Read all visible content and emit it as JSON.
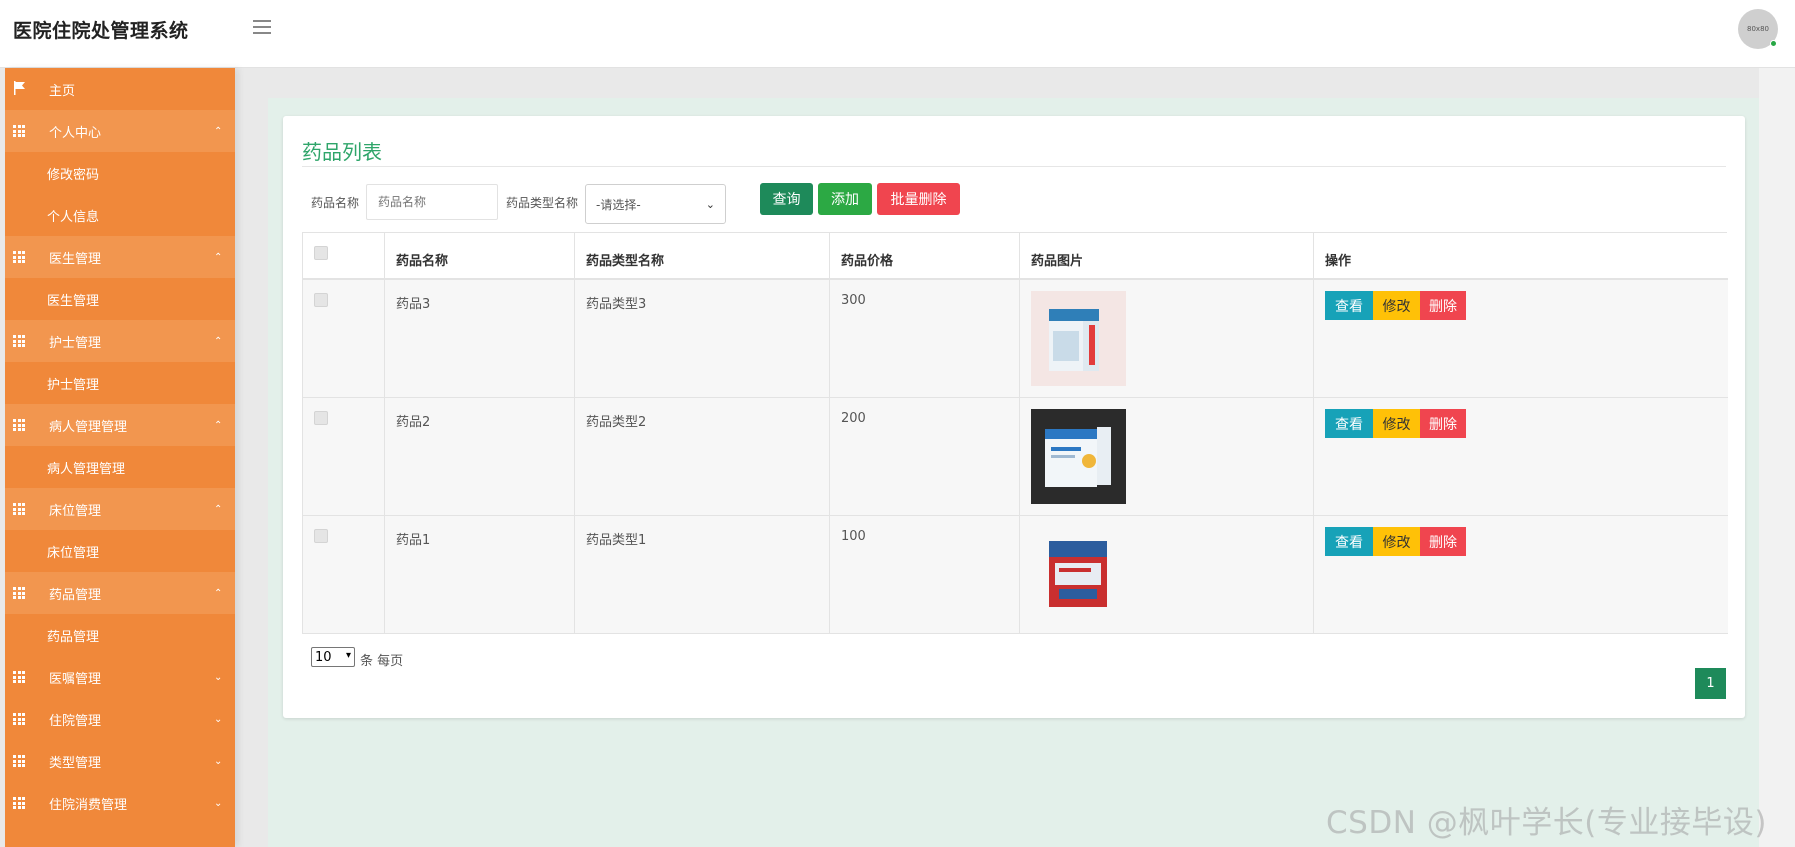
{
  "app": {
    "title": "医院住院处管理系统",
    "avatar_text": "80x80"
  },
  "sidebar": {
    "home": "主页",
    "groups": [
      {
        "label": "个人中心",
        "chevron": "⌃",
        "open": true,
        "children": [
          "修改密码",
          "个人信息"
        ]
      },
      {
        "label": "医生管理",
        "chevron": "⌃",
        "open": true,
        "children": [
          "医生管理"
        ]
      },
      {
        "label": "护士管理",
        "chevron": "⌃",
        "open": true,
        "children": [
          "护士管理"
        ]
      },
      {
        "label": "病人管理管理",
        "chevron": "⌃",
        "open": true,
        "children": [
          "病人管理管理"
        ]
      },
      {
        "label": "床位管理",
        "chevron": "⌃",
        "open": true,
        "children": [
          "床位管理"
        ]
      },
      {
        "label": "药品管理",
        "chevron": "⌃",
        "open": true,
        "children": [
          "药品管理"
        ]
      },
      {
        "label": "医嘱管理",
        "chevron": "⌄",
        "open": false,
        "children": []
      },
      {
        "label": "住院管理",
        "chevron": "⌄",
        "open": false,
        "children": []
      },
      {
        "label": "类型管理",
        "chevron": "⌄",
        "open": false,
        "children": []
      },
      {
        "label": "住院消费管理",
        "chevron": "⌄",
        "open": false,
        "children": []
      }
    ]
  },
  "page": {
    "title": "药品列表",
    "search": {
      "name_label": "药品名称",
      "name_placeholder": "药品名称",
      "type_label": "药品类型名称",
      "type_selected": "-请选择-",
      "query_btn": "查询",
      "add_btn": "添加",
      "batch_delete_btn": "批量删除"
    },
    "table": {
      "headers": [
        "药品名称",
        "药品类型名称",
        "药品价格",
        "药品图片",
        "操作"
      ],
      "rows": [
        {
          "name": "药品3",
          "type": "药品类型3",
          "price": "300"
        },
        {
          "name": "药品2",
          "type": "药品类型2",
          "price": "200"
        },
        {
          "name": "药品1",
          "type": "药品类型1",
          "price": "100"
        }
      ],
      "actions": {
        "view": "查看",
        "edit": "修改",
        "delete": "删除"
      }
    },
    "pagination": {
      "page_size": "10",
      "page_size_label": "条 每页",
      "current_page": "1"
    }
  },
  "colors": {
    "sidebar": "#f0883a",
    "title_green": "#2fa56a",
    "query": "#1e8a5a",
    "add": "#2ca944",
    "batch_delete": "#f0454f",
    "view": "#17a2b8",
    "edit": "#ffc107",
    "delete": "#f0454f"
  },
  "watermark": "CSDN @枫叶学长(专业接毕设)"
}
